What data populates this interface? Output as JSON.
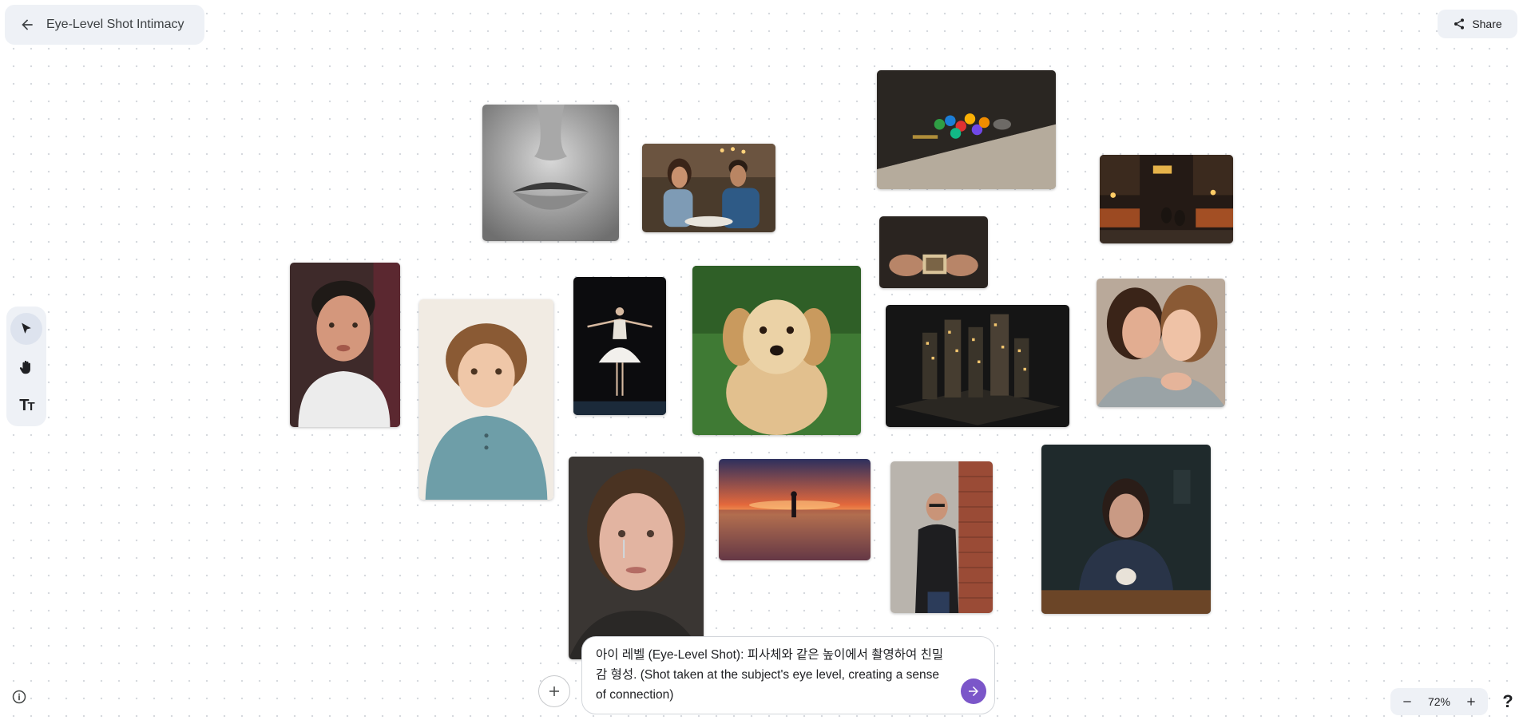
{
  "header": {
    "title": "Eye-Level Shot Intimacy",
    "share_label": "Share"
  },
  "toolbar": {
    "tools": [
      {
        "name": "select-tool",
        "icon": "cursor-arrow-icon",
        "active": true
      },
      {
        "name": "pan-tool",
        "icon": "hand-icon",
        "active": false
      },
      {
        "name": "text-tool",
        "icon": "text-size-icon",
        "active": false
      }
    ]
  },
  "images": [
    {
      "name": "lips-closeup-image"
    },
    {
      "name": "couple-cafe-image"
    },
    {
      "name": "glass-marbles-image"
    },
    {
      "name": "night-market-image"
    },
    {
      "name": "old-photo-hands-image"
    },
    {
      "name": "wet-young-man-image"
    },
    {
      "name": "curly-child-image"
    },
    {
      "name": "ballerina-image"
    },
    {
      "name": "golden-retriever-image"
    },
    {
      "name": "miniature-city-image"
    },
    {
      "name": "two-women-embrace-image"
    },
    {
      "name": "crying-woman-image"
    },
    {
      "name": "sunset-beach-image"
    },
    {
      "name": "man-brick-wall-image"
    },
    {
      "name": "woman-at-table-image"
    }
  ],
  "prompt": {
    "line1": "아이 레벨 (Eye-Level Shot): 피사체와 같은 높이에서 촬영하여 친밀",
    "line2": "감 형성. (Shot taken at the subject's eye level, creating a sense",
    "line3": "of connection)"
  },
  "zoom": {
    "level": "72%"
  },
  "help_label": "?",
  "colors": {
    "panel_bg": "#eef1f6",
    "send_button": "#7b56c9",
    "canvas_dots": "#d6d9de"
  }
}
